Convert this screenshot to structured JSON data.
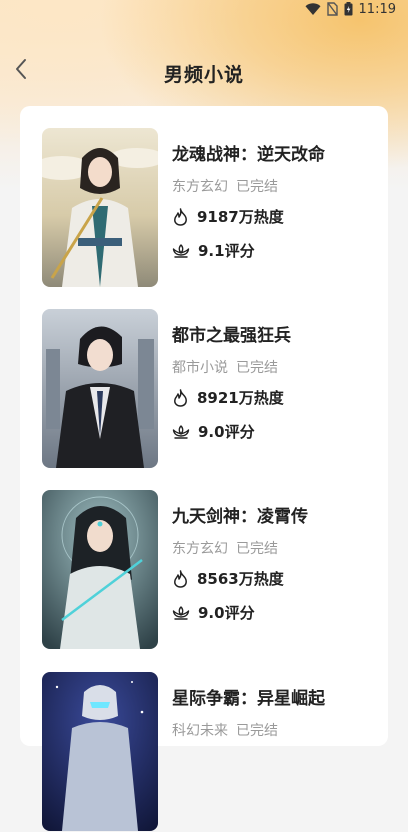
{
  "status_bar": {
    "time": "11:19"
  },
  "header": {
    "title": "男频小说"
  },
  "books": [
    {
      "title": "龙魂战神：逆天改命",
      "category": "东方玄幻",
      "status": "已完结",
      "heat": "9187万热度",
      "score": "9.1评分",
      "cover_colors": {
        "bg": "#d9cfb4",
        "sky": "#e8e2cf",
        "robe": "#e9e7e0",
        "hair": "#2a2420",
        "accent": "#2f6b73"
      }
    },
    {
      "title": "都市之最强狂兵",
      "category": "都市小说",
      "status": "已完结",
      "heat": "8921万热度",
      "score": "9.0评分",
      "cover_colors": {
        "bg": "#8f99a6",
        "sky": "#c7cdd4",
        "robe": "#1f2024",
        "hair": "#1c1c20",
        "accent": "#e8e8ea"
      }
    },
    {
      "title": "九天剑神：凌霄传",
      "category": "东方玄幻",
      "status": "已完结",
      "heat": "8563万热度",
      "score": "9.0评分",
      "cover_colors": {
        "bg": "#3f555b",
        "sky": "#7fa1a6",
        "robe": "#dfe6e6",
        "hair": "#1d2226",
        "accent": "#4fd1d9"
      }
    },
    {
      "title": "星际争霸：异星崛起",
      "category": "科幻未来",
      "status": "已完结",
      "heat": "",
      "score": "",
      "cover_colors": {
        "bg": "#141a3a",
        "sky": "#2d3978",
        "robe": "#b9c3d6",
        "hair": "#d9dee8",
        "accent": "#6ee7ff"
      }
    }
  ]
}
